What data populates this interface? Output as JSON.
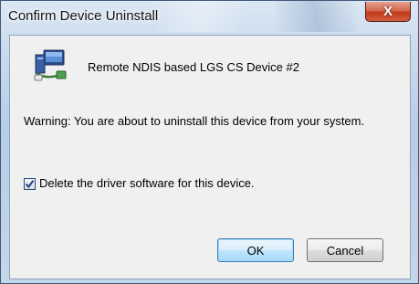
{
  "window": {
    "title": "Confirm Device Uninstall",
    "close_glyph": "X"
  },
  "device": {
    "icon": "network-adapter-icon",
    "name": "Remote NDIS based LGS CS Device #2"
  },
  "warning_text": "Warning: You are about to uninstall this device from your system.",
  "delete_driver": {
    "checked": true,
    "label": "Delete the driver software for this device."
  },
  "buttons": {
    "ok": "OK",
    "cancel": "Cancel"
  },
  "colors": {
    "close_button": "#c2391c",
    "ok_button_border": "#3c7fb1"
  }
}
